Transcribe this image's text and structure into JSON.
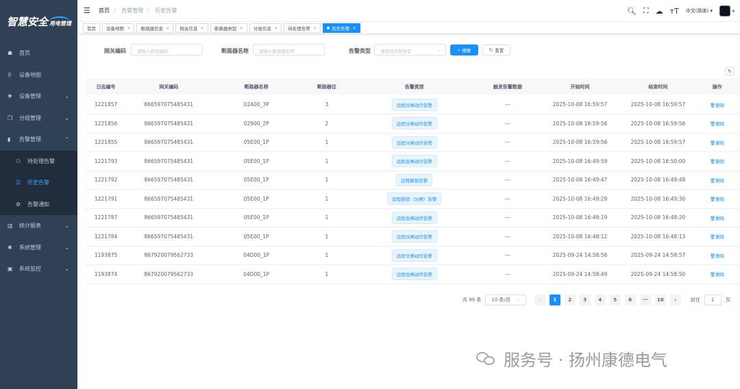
{
  "logo": {
    "main": "智慧安全",
    "sub": "用电管理"
  },
  "sidebar": {
    "items": [
      {
        "label": "首页",
        "icon": "dashboard-icon"
      },
      {
        "label": "设备地图",
        "icon": "map-icon"
      },
      {
        "label": "设备管理",
        "icon": "device-icon"
      },
      {
        "label": "分组管理",
        "icon": "group-icon"
      },
      {
        "label": "告警管理",
        "icon": "alarm-icon"
      },
      {
        "label": "统计报表",
        "icon": "chart-icon"
      },
      {
        "label": "系统管理",
        "icon": "gear-icon"
      },
      {
        "label": "系统监控",
        "icon": "monitor-icon"
      }
    ],
    "sub": [
      {
        "label": "待处理告警"
      },
      {
        "label": "历史告警"
      },
      {
        "label": "告警通知"
      }
    ]
  },
  "breadcrumb": [
    "首页",
    "告警管理",
    "历史告警"
  ],
  "header": {
    "language": "中文(简体)"
  },
  "tags": [
    "首页",
    "设备地图",
    "断路器信息",
    "网关信息",
    "断路器类型",
    "分组信息",
    "待处理告警",
    "历史告警"
  ],
  "search": {
    "gateway_label": "网关编码",
    "gateway_placeholder": "请输入网关编码",
    "breaker_label": "断路器名称",
    "breaker_placeholder": "请输入断路器名称",
    "type_label": "告警类型",
    "type_placeholder": "请选择告警类型",
    "search_btn": "搜索",
    "reset_btn": "重置"
  },
  "table": {
    "headers": [
      "日志编号",
      "网关编码",
      "断路器名称",
      "断路器位",
      "告警类型",
      "触发告警数据",
      "开始时间",
      "结束时间",
      "操作"
    ],
    "delete_label": "删除",
    "rows": [
      [
        "1221857",
        "866597075485431",
        "02A00_3P",
        "3",
        "远程分闸动作告警",
        "---",
        "2025-10-08 16:59:57",
        "2025-10-08 16:59:57"
      ],
      [
        "1221856",
        "866597075485431",
        "02900_2P",
        "2",
        "远程分闸动作告警",
        "---",
        "2025-10-08 16:59:56",
        "2025-10-08 16:59:56"
      ],
      [
        "1221855",
        "866597075485431",
        "05E00_1P",
        "1",
        "远程分闸动作告警",
        "---",
        "2025-10-08 16:59:56",
        "2025-10-08 16:59:57"
      ],
      [
        "1221793",
        "866597075485431",
        "05E00_1P",
        "1",
        "远程合闸动作告警",
        "---",
        "2025-10-08 16:49:59",
        "2025-10-08 16:50:00"
      ],
      [
        "1221792",
        "866597075485431",
        "05E00_1P",
        "1",
        "远程解锁告警",
        "---",
        "2025-10-08 16:49:47",
        "2025-10-08 16:49:48"
      ],
      [
        "1221791",
        "866597075485431",
        "05E00_1P",
        "1",
        "远程挂锁（分闸）告警",
        "---",
        "2025-10-08 16:49:29",
        "2025-10-08 16:49:30"
      ],
      [
        "1221787",
        "866597075485431",
        "05E00_1P",
        "1",
        "远程合闸动作告警",
        "---",
        "2025-10-08 16:48:19",
        "2025-10-08 16:48:20"
      ],
      [
        "1221784",
        "866597075485431",
        "05E00_1P",
        "1",
        "远程分闸动作告警",
        "---",
        "2025-10-08 16:48:12",
        "2025-10-08 16:48:13"
      ],
      [
        "1193875",
        "867920079562733",
        "04D00_1P",
        "1",
        "远程分闸动作告警",
        "---",
        "2025-09-24 14:58:56",
        "2025-09-24 14:58:57"
      ],
      [
        "1193874",
        "867920079562733",
        "04D00_1P",
        "1",
        "远程合闸动作告警",
        "---",
        "2025-09-24 14:58:49",
        "2025-09-24 14:58:50"
      ]
    ]
  },
  "pagination": {
    "total": "共 99 条",
    "page_size": "10 条/页",
    "pages": [
      "1",
      "2",
      "3",
      "4",
      "5",
      "6",
      "···",
      "10"
    ],
    "current": "1",
    "goto_label": "前往",
    "goto_value": "1",
    "page_unit": "页"
  },
  "watermark": "服务号 · 扬州康德电气"
}
